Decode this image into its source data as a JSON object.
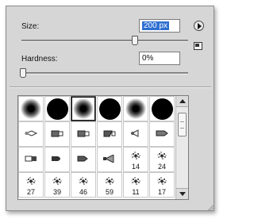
{
  "size": {
    "label": "Size:",
    "value": "200 px",
    "slider_fraction": 0.7
  },
  "hardness": {
    "label": "Hardness:",
    "value": "0%",
    "slider_fraction": 0.0
  },
  "icons": {
    "menu": "flyout-menu-arrow-icon",
    "save_preset": "save-preset-icon",
    "resize": "resize-grip-icon"
  },
  "colors": {
    "selection": "#2f6fd1",
    "panel": "#d6d6d6"
  },
  "brushes": [
    {
      "type": "soft",
      "num": ""
    },
    {
      "type": "hard",
      "num": ""
    },
    {
      "type": "soft",
      "num": "",
      "selected": true
    },
    {
      "type": "hard",
      "num": ""
    },
    {
      "type": "soft",
      "num": ""
    },
    {
      "type": "hard",
      "num": ""
    },
    {
      "type": "pencil",
      "num": ""
    },
    {
      "type": "brush-flat",
      "num": ""
    },
    {
      "type": "brush-flat",
      "num": ""
    },
    {
      "type": "brush-angled",
      "num": ""
    },
    {
      "type": "airbrush",
      "num": ""
    },
    {
      "type": "marker",
      "num": ""
    },
    {
      "type": "eraser",
      "num": ""
    },
    {
      "type": "round-tip",
      "num": ""
    },
    {
      "type": "wide-tip",
      "num": ""
    },
    {
      "type": "fan",
      "num": ""
    },
    {
      "type": "splatter",
      "num": "14"
    },
    {
      "type": "splatter",
      "num": "24"
    },
    {
      "type": "splatter",
      "num": "27"
    },
    {
      "type": "splatter",
      "num": "39"
    },
    {
      "type": "splatter",
      "num": "46"
    },
    {
      "type": "splatter",
      "num": "59"
    },
    {
      "type": "splatter",
      "num": "11"
    },
    {
      "type": "splatter",
      "num": "17"
    }
  ]
}
